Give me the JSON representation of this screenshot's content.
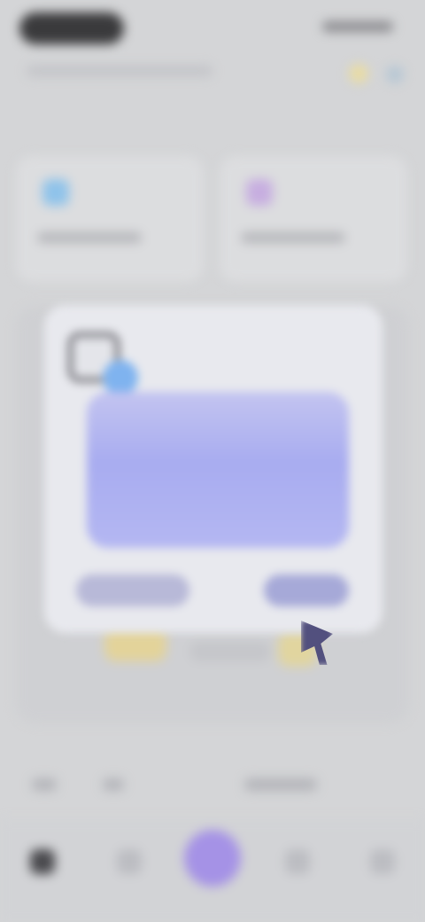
{
  "status_bar": {
    "time_pill": "",
    "indicators": ""
  },
  "header": {
    "subtitle": "",
    "section_title": ""
  },
  "quick_actions": [
    {
      "label": "",
      "icon": "blue-square-icon",
      "color": "#8fc3ea"
    },
    {
      "label": "",
      "icon": "purple-square-icon",
      "color": "#c7aee0"
    }
  ],
  "dialog": {
    "icon": "window-app-icon",
    "heading": "",
    "secondary_label": "",
    "primary_label": ""
  },
  "tabbar": {
    "items": [
      {
        "label": "",
        "icon": "home-icon"
      },
      {
        "label": "",
        "icon": "list-icon"
      },
      {
        "label": "",
        "icon": "add-icon"
      },
      {
        "label": "",
        "icon": "chart-icon"
      },
      {
        "label": "",
        "icon": "profile-icon"
      }
    ],
    "fab_color": "#a592e6"
  },
  "colors": {
    "background": "#d4d5d7",
    "dialog": "#e8e9ee",
    "accent": "#a8acf0",
    "icon_blue": "#7fb3ef"
  }
}
